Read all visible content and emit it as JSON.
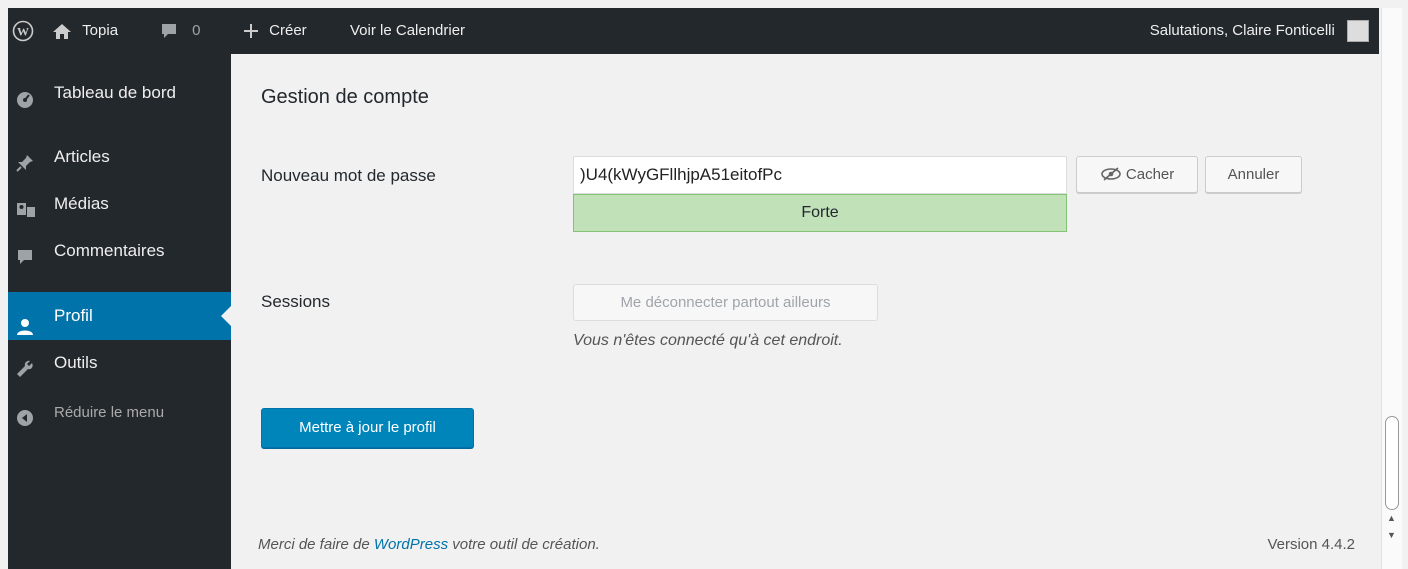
{
  "adminbar": {
    "site_name": "Topia",
    "comments_count": "0",
    "new_label": "Créer",
    "calendar_label": "Voir le Calendrier",
    "greeting": "Salutations, Claire Fonticelli"
  },
  "sidebar": {
    "items": [
      {
        "label": "Tableau de bord",
        "icon": "dashboard-icon"
      },
      {
        "label": "Articles",
        "icon": "pin-icon"
      },
      {
        "label": "Médias",
        "icon": "media-icon"
      },
      {
        "label": "Commentaires",
        "icon": "comment-icon"
      },
      {
        "label": "Profil",
        "icon": "user-icon",
        "current": true
      },
      {
        "label": "Outils",
        "icon": "wrench-icon"
      },
      {
        "label": "Réduire le menu",
        "icon": "collapse-icon"
      }
    ]
  },
  "content": {
    "section_title": "Gestion de compte",
    "password_label": "Nouveau mot de passe",
    "password_value": ")U4(kWyGFllhjpA51eitofPc",
    "strength_label": "Forte",
    "hide_label": "Cacher",
    "cancel_label": "Annuler",
    "sessions_label": "Sessions",
    "logout_everywhere_label": "Me déconnecter partout ailleurs",
    "sessions_note": "Vous n'êtes connecté qu'à cet endroit.",
    "update_button": "Mettre à jour le profil"
  },
  "footer": {
    "thanks_prefix": "Merci de faire de ",
    "thanks_link": "WordPress",
    "thanks_suffix": " votre outil de création.",
    "version": "Version 4.4.2"
  },
  "colors": {
    "admin_dark": "#23282d",
    "accent_blue": "#0073aa",
    "primary_button": "#0085ba",
    "strength_green": "#c1e1b9"
  }
}
